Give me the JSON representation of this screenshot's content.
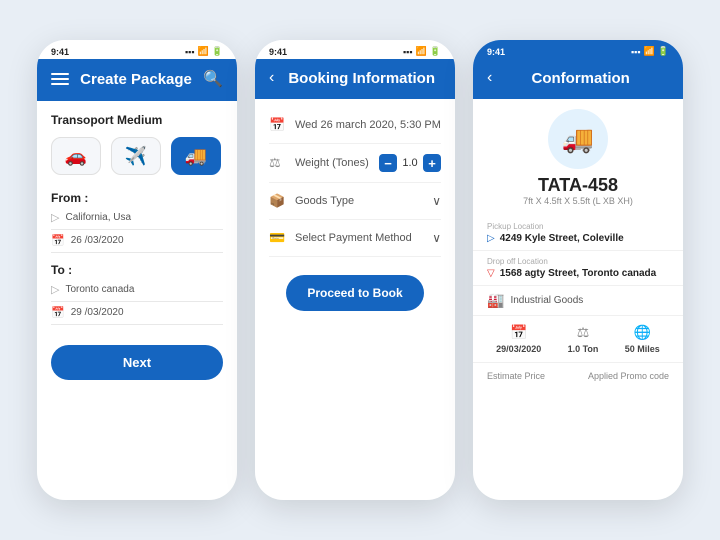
{
  "app": {
    "background": "#e8eef5"
  },
  "phone1": {
    "status_time": "9:41",
    "header_title": "Create Package",
    "section_label": "Transoport Medium",
    "transport": [
      {
        "id": "car",
        "icon": "🚗",
        "active": false
      },
      {
        "id": "plane",
        "icon": "✈️",
        "active": false
      },
      {
        "id": "truck",
        "icon": "🚚",
        "active": true
      }
    ],
    "from_label": "From :",
    "from_location": "California, Usa",
    "from_date": "26 /03/2020",
    "to_label": "To :",
    "to_location": "Toronto canada",
    "to_date": "29 /03/2020",
    "next_button": "Next"
  },
  "phone2": {
    "status_time": "9:41",
    "header_title": "Booking Information",
    "datetime": "Wed 26 march 2020,  5:30 PM",
    "weight_label": "Weight (Tones)",
    "weight_value": "1.0",
    "goods_label": "Goods Type",
    "payment_label": "Select Payment Method",
    "proceed_button": "Proceed to Book"
  },
  "phone3": {
    "status_time": "9:41",
    "header_title": "Conformation",
    "vehicle_id": "TATA-458",
    "vehicle_dims": "7ft X 4.5ft X 5.5ft (L XB XH)",
    "pickup_sublabel": "Pickup Location",
    "pickup_address": "4249 Kyle Street, Coleville",
    "dropoff_sublabel": "Drop off Location",
    "dropoff_address": "1568 agty Street, Toronto canada",
    "goods_type": "Industrial Goods",
    "stat1_val": "29/03/2020",
    "stat2_val": "1.0 Ton",
    "stat3_val": "50 Miles",
    "estimate_label": "Estimate Price",
    "promo_label": "Applied Promo code"
  }
}
